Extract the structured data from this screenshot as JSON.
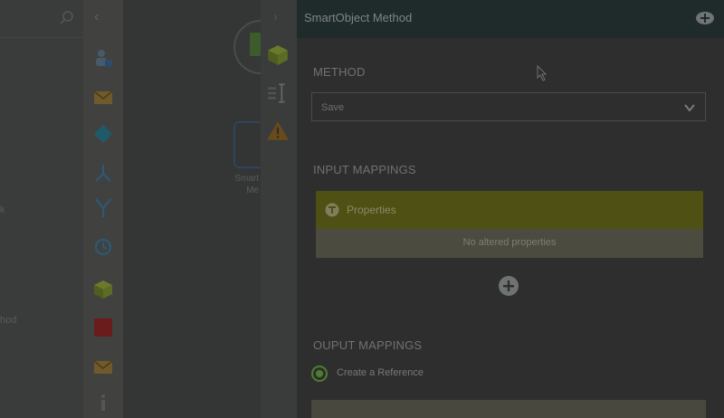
{
  "panel": {
    "title": "SmartObject Method",
    "close_icon": "add-circle-icon",
    "method": {
      "section_label": "METHOD",
      "selected_value": "Save"
    },
    "input_mappings": {
      "section_label": "INPUT MAPPINGS",
      "properties_title": "Properties",
      "empty_message": "No altered properties"
    },
    "output_mappings": {
      "section_label": "OUPUT MAPPINGS",
      "radio_label": "Create a Reference"
    }
  },
  "canvas": {
    "node_label_line1": "Smart",
    "node_label_line2": "Me"
  },
  "background": {
    "left_partial_text": "k",
    "left_partial_node": "hod"
  },
  "colors": {
    "panel_header": "#1f2a2b",
    "properties_header": "#4f5013",
    "radio_accent": "#4c7e2f"
  },
  "toolbox_icons": [
    "user-task-icon",
    "email-icon",
    "decision-icon",
    "split-icon",
    "merge-icon",
    "timer-icon",
    "smartobject-icon",
    "stop-icon",
    "email-icon",
    "info-icon"
  ],
  "side_strip_icons": [
    "smartobject-icon",
    "text-cursor-icon",
    "warning-icon"
  ]
}
